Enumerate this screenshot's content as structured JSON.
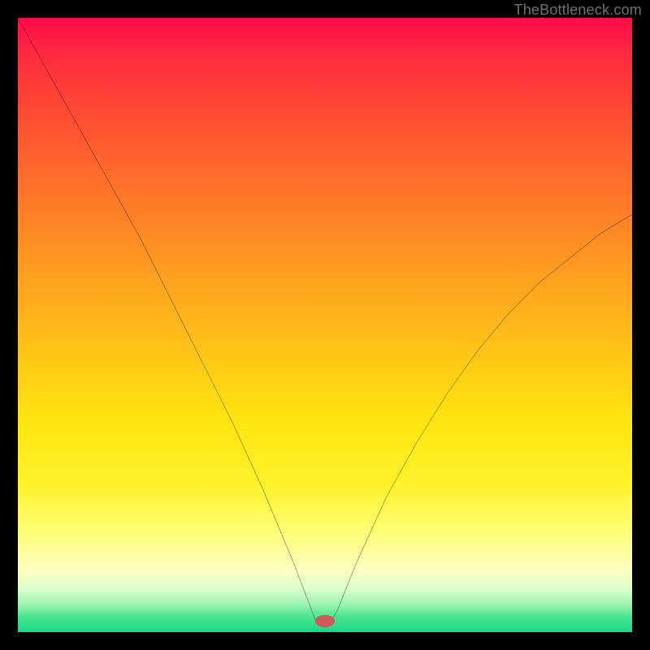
{
  "watermark": "TheBottleneck.com",
  "chart_data": {
    "type": "line",
    "title": "",
    "xlabel": "",
    "ylabel": "",
    "xlim": [
      0,
      100
    ],
    "ylim": [
      0,
      100
    ],
    "grid": false,
    "legend": false,
    "series": [
      {
        "name": "curve",
        "color": "#000000",
        "x": [
          0,
          5,
          10,
          15,
          20,
          25,
          30,
          35,
          40,
          45,
          48.5,
          49,
          51,
          52,
          55,
          60,
          65,
          70,
          75,
          80,
          85,
          90,
          95,
          100
        ],
        "y": [
          100,
          91,
          82,
          73,
          64,
          54,
          44,
          34,
          23,
          11,
          1.8,
          1.8,
          1.8,
          3.5,
          11,
          22,
          31,
          39,
          46,
          52,
          57,
          61,
          65,
          68
        ]
      }
    ],
    "marker": {
      "cx": 50,
      "cy": 1.8,
      "rx": 1.6,
      "ry": 1.0,
      "fill": "#cf5a5a"
    }
  }
}
